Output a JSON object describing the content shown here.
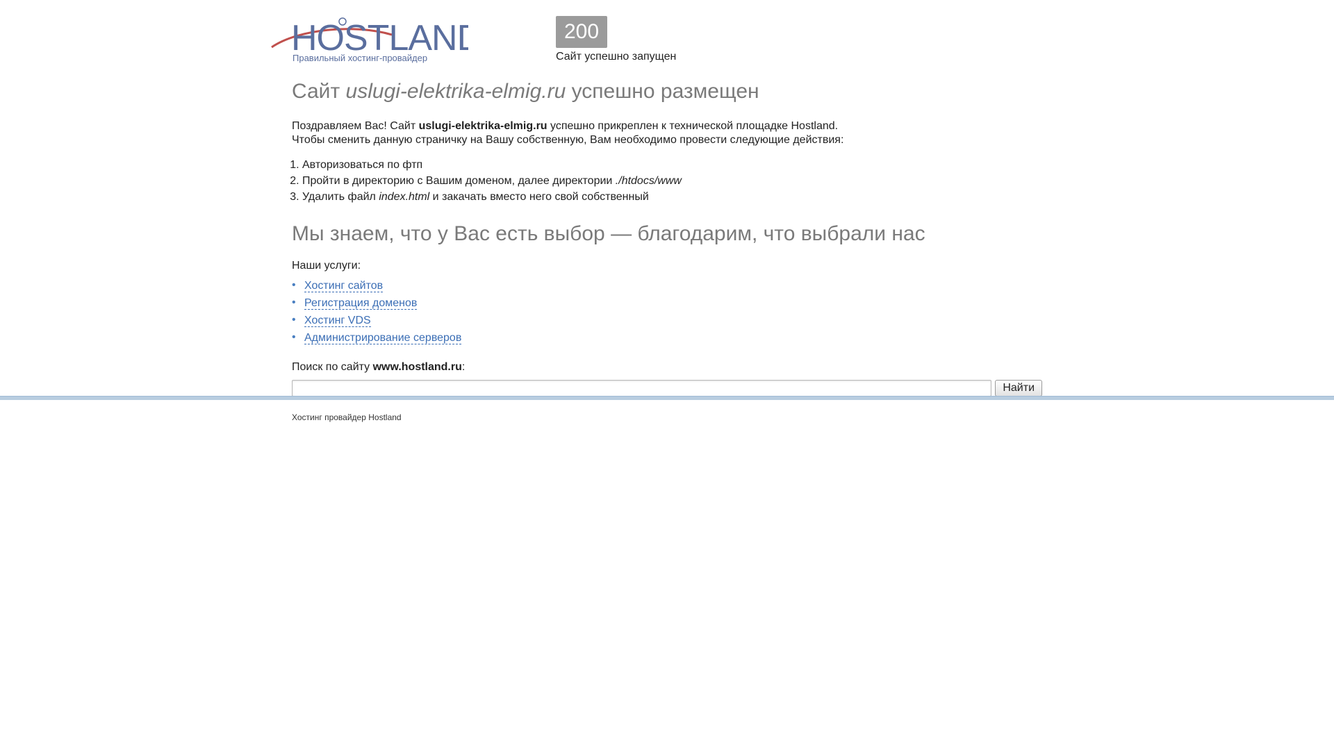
{
  "logo": {
    "wordmark": "HOSTLAND",
    "tagline": "Правильный хостинг-провайдер"
  },
  "status": {
    "code": "200",
    "text": "Сайт успешно запущен"
  },
  "main": {
    "title_prefix": "Сайт ",
    "site_name": "uslugi-elektrika-elmig.ru",
    "title_suffix": " успешно размещен",
    "intro": {
      "line1_prefix": "Поздравляем Вас! Сайт ",
      "line1_site": "uslugi-elektrika-elmig.ru",
      "line1_suffix": " успешно прикреплен к технической площадке Hostland.",
      "line2": "Чтобы сменить данную страничку на Вашу собственную, Вам необходимо провести следующие действия:"
    },
    "steps": [
      {
        "text": "Авторизоваться по фтп"
      },
      {
        "prefix": "Пройти в директорию с Вашим доменом, далее директории ",
        "path": "./htdocs/www"
      },
      {
        "prefix": "Удалить файл ",
        "file": "index.html",
        "suffix": " и закачать вместо него свой собственный"
      }
    ],
    "subtitle": "Мы знаем, что у Вас есть выбор — благодарим, что выбрали нас",
    "services_label": "Наши услуги:",
    "services": [
      "Хостинг сайтов",
      "Регистрация доменов",
      "Хостинг VDS",
      "Администрирование серверов"
    ],
    "search": {
      "label_prefix": "Поиск по сайту ",
      "label_site": "www.hostland.ru",
      "label_suffix": ":",
      "value": "",
      "placeholder": "",
      "button_label": "Найти"
    }
  },
  "footer": {
    "text": "Хостинг провайдер Hostland"
  },
  "colors": {
    "status_bg": "#9b9b9b",
    "heading": "#7a7a7a",
    "link": "#3b6eb5",
    "divider": "#b8cde0",
    "logo_arc": "#c0504d",
    "logo_text": "#5a6e9e"
  }
}
